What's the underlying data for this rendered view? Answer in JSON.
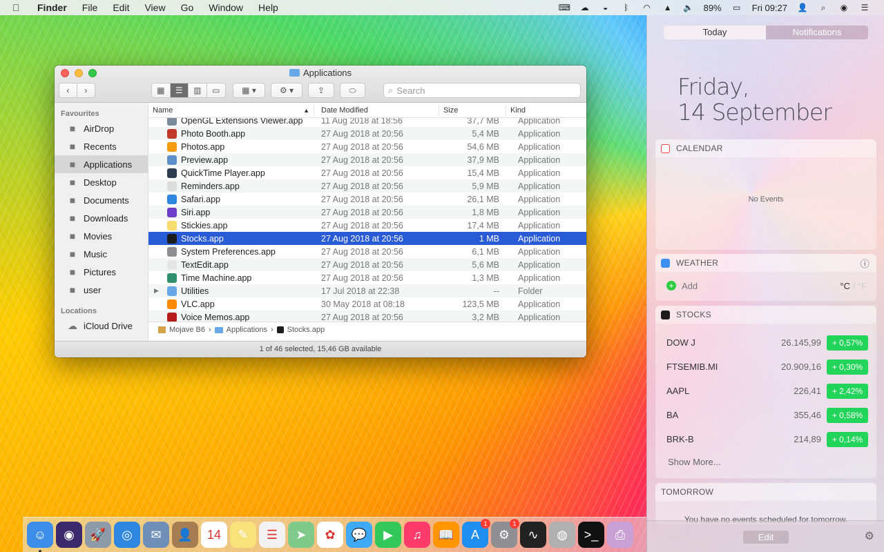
{
  "menubar": {
    "app": "Finder",
    "items": [
      "File",
      "Edit",
      "View",
      "Go",
      "Window",
      "Help"
    ],
    "battery": "89%",
    "clock": "Fri 09:27"
  },
  "window": {
    "title": "Applications",
    "search_placeholder": "Search",
    "sidebar": {
      "favourites_header": "Favourites",
      "favourites": [
        {
          "label": "AirDrop",
          "icon": "airdrop-icon"
        },
        {
          "label": "Recents",
          "icon": "recents-icon"
        },
        {
          "label": "Applications",
          "icon": "applications-icon"
        },
        {
          "label": "Desktop",
          "icon": "desktop-icon"
        },
        {
          "label": "Documents",
          "icon": "documents-icon"
        },
        {
          "label": "Downloads",
          "icon": "downloads-icon"
        },
        {
          "label": "Movies",
          "icon": "movies-icon"
        },
        {
          "label": "Music",
          "icon": "music-icon"
        },
        {
          "label": "Pictures",
          "icon": "pictures-icon"
        },
        {
          "label": "user",
          "icon": "home-icon"
        }
      ],
      "locations_header": "Locations",
      "locations": [
        {
          "label": "iCloud Drive",
          "icon": "icloud-icon"
        }
      ]
    },
    "columns": {
      "name": "Name",
      "date": "Date Modified",
      "size": "Size",
      "kind": "Kind"
    },
    "rows": [
      {
        "name": "OpenGL Extensions Viewer.app",
        "date": "11 Aug 2018 at 18:56",
        "size": "37,7 MB",
        "kind": "Application",
        "color": "#7a8b9c"
      },
      {
        "name": "Photo Booth.app",
        "date": "27 Aug 2018 at 20:56",
        "size": "5,4 MB",
        "kind": "Application",
        "color": "#c0392b"
      },
      {
        "name": "Photos.app",
        "date": "27 Aug 2018 at 20:56",
        "size": "54,6 MB",
        "kind": "Application",
        "color": "#f39c12"
      },
      {
        "name": "Preview.app",
        "date": "27 Aug 2018 at 20:56",
        "size": "37,9 MB",
        "kind": "Application",
        "color": "#5d8fc9"
      },
      {
        "name": "QuickTime Player.app",
        "date": "27 Aug 2018 at 20:56",
        "size": "15,4 MB",
        "kind": "Application",
        "color": "#2c3e50"
      },
      {
        "name": "Reminders.app",
        "date": "27 Aug 2018 at 20:56",
        "size": "5,9 MB",
        "kind": "Application",
        "color": "#dcdcdc"
      },
      {
        "name": "Safari.app",
        "date": "27 Aug 2018 at 20:56",
        "size": "26,1 MB",
        "kind": "Application",
        "color": "#2e86de"
      },
      {
        "name": "Siri.app",
        "date": "27 Aug 2018 at 20:56",
        "size": "1,8 MB",
        "kind": "Application",
        "color": "#6c3ec9"
      },
      {
        "name": "Stickies.app",
        "date": "27 Aug 2018 at 20:56",
        "size": "17,4 MB",
        "kind": "Application",
        "color": "#f7dc6f"
      },
      {
        "name": "Stocks.app",
        "date": "27 Aug 2018 at 20:56",
        "size": "1 MB",
        "kind": "Application",
        "color": "#1c1c1c",
        "selected": true
      },
      {
        "name": "System Preferences.app",
        "date": "27 Aug 2018 at 20:56",
        "size": "6,1 MB",
        "kind": "Application",
        "color": "#8e8e93"
      },
      {
        "name": "TextEdit.app",
        "date": "27 Aug 2018 at 20:56",
        "size": "5,6 MB",
        "kind": "Application",
        "color": "#e5e5e5"
      },
      {
        "name": "Time Machine.app",
        "date": "27 Aug 2018 at 20:56",
        "size": "1,3 MB",
        "kind": "Application",
        "color": "#2f8f6f"
      },
      {
        "name": "Utilities",
        "date": "17 Jul 2018 at 22:38",
        "size": "--",
        "kind": "Folder",
        "color": "#68a8e8",
        "folder": true
      },
      {
        "name": "VLC.app",
        "date": "30 May 2018 at 08:18",
        "size": "123,5 MB",
        "kind": "Application",
        "color": "#ff8c00"
      },
      {
        "name": "Voice Memos.app",
        "date": "27 Aug 2018 at 20:56",
        "size": "3,2 MB",
        "kind": "Application",
        "color": "#b71c1c"
      }
    ],
    "path": [
      "Mojave B6",
      "Applications",
      "Stocks.app"
    ],
    "status": "1 of 46 selected, 15,46 GB available"
  },
  "nc": {
    "tabs": [
      "Today",
      "Notifications"
    ],
    "day": "Friday,",
    "date": "14 September",
    "calendar": {
      "title": "CALENDAR",
      "empty": "No Events"
    },
    "weather": {
      "title": "WEATHER",
      "add": "Add",
      "unit_c": "°C",
      "sep": "/",
      "unit_f": "°F"
    },
    "stocks": {
      "title": "STOCKS",
      "items": [
        {
          "symbol": "DOW J",
          "price": "26.145,99",
          "change": "+ 0,57%"
        },
        {
          "symbol": "FTSEMIB.MI",
          "price": "20.909,16",
          "change": "+ 0,30%"
        },
        {
          "symbol": "AAPL",
          "price": "226,41",
          "change": "+ 2,42%"
        },
        {
          "symbol": "BA",
          "price": "355,46",
          "change": "+ 0,58%"
        },
        {
          "symbol": "BRK-B",
          "price": "214,89",
          "change": "+ 0,14%"
        }
      ],
      "more": "Show More..."
    },
    "tomorrow": {
      "title": "TOMORROW",
      "text": "You have no events scheduled for tomorrow."
    },
    "edit": "Edit"
  },
  "dock": {
    "items": [
      {
        "name": "finder",
        "color": "#3d8ee8",
        "glyph": "☺",
        "running": true
      },
      {
        "name": "siri",
        "color": "#3b2a6b",
        "glyph": "◉"
      },
      {
        "name": "launchpad",
        "color": "#8e9aa8",
        "glyph": "🚀"
      },
      {
        "name": "safari",
        "color": "#2e86de",
        "glyph": "◎"
      },
      {
        "name": "mail",
        "color": "#6f8fb8",
        "glyph": "✉"
      },
      {
        "name": "contacts",
        "color": "#a67c52",
        "glyph": "👤"
      },
      {
        "name": "calendar",
        "color": "#ffffff",
        "glyph": "14"
      },
      {
        "name": "notes",
        "color": "#f7e27c",
        "glyph": "✎"
      },
      {
        "name": "reminders",
        "color": "#f2f2f2",
        "glyph": "☰"
      },
      {
        "name": "maps",
        "color": "#7fc98b",
        "glyph": "➤"
      },
      {
        "name": "photos",
        "color": "#ffffff",
        "glyph": "✿"
      },
      {
        "name": "messages",
        "color": "#3fa9f5",
        "glyph": "💬"
      },
      {
        "name": "facetime",
        "color": "#34c759",
        "glyph": "▶"
      },
      {
        "name": "itunes",
        "color": "#ff3b6b",
        "glyph": "♫"
      },
      {
        "name": "ibooks",
        "color": "#ff9500",
        "glyph": "📖"
      },
      {
        "name": "app-store",
        "color": "#1f8ef1",
        "glyph": "A",
        "badge": "1"
      },
      {
        "name": "system-preferences",
        "color": "#8e8e93",
        "glyph": "⚙",
        "badge": "1"
      },
      {
        "name": "activity-monitor",
        "color": "#222222",
        "glyph": "∿"
      },
      {
        "name": "disk-utility",
        "color": "#b0b0b0",
        "glyph": "◍"
      },
      {
        "name": "terminal",
        "color": "#111111",
        "glyph": ">_"
      },
      {
        "name": "printer",
        "color": "#c9a0d6",
        "glyph": "⎙"
      }
    ]
  }
}
